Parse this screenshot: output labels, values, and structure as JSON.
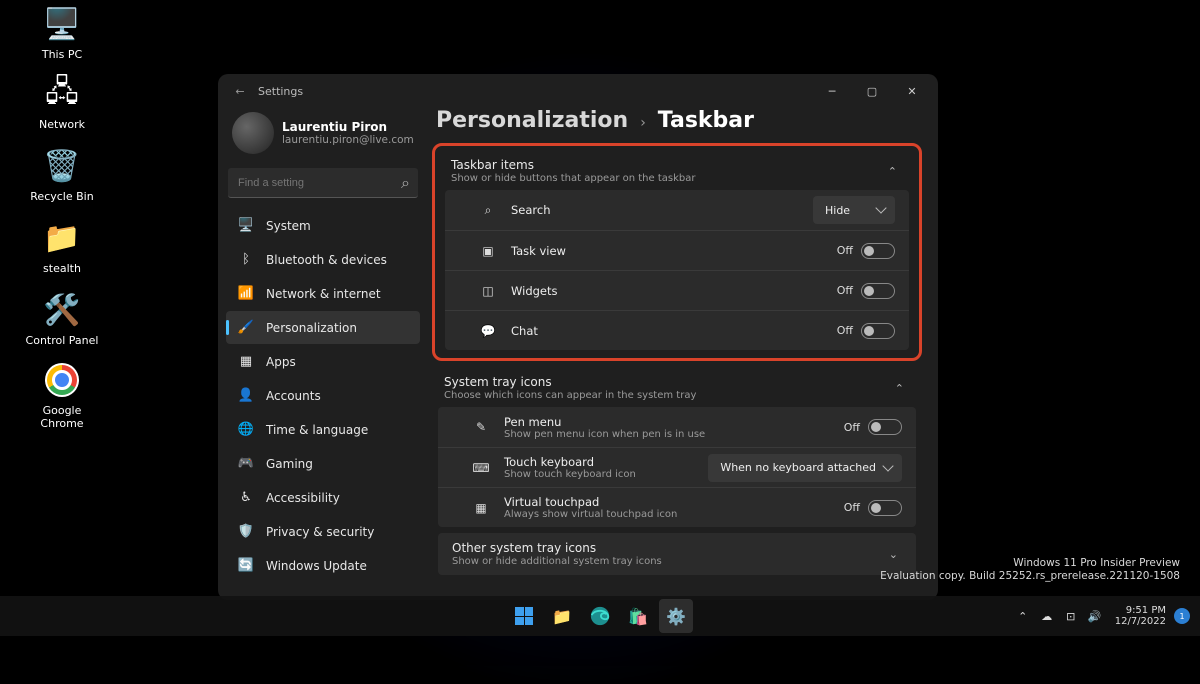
{
  "desktop_icons": [
    {
      "label": "This PC"
    },
    {
      "label": "Network"
    },
    {
      "label": "Recycle Bin"
    },
    {
      "label": "stealth"
    },
    {
      "label": "Control Panel"
    },
    {
      "label": "Google Chrome"
    }
  ],
  "window": {
    "title": "Settings",
    "user": {
      "name": "Laurentiu Piron",
      "email": "laurentiu.piron@live.com"
    },
    "search_placeholder": "Find a setting",
    "nav": [
      {
        "label": "System",
        "sel": false
      },
      {
        "label": "Bluetooth & devices",
        "sel": false
      },
      {
        "label": "Network & internet",
        "sel": false
      },
      {
        "label": "Personalization",
        "sel": true
      },
      {
        "label": "Apps",
        "sel": false
      },
      {
        "label": "Accounts",
        "sel": false
      },
      {
        "label": "Time & language",
        "sel": false
      },
      {
        "label": "Gaming",
        "sel": false
      },
      {
        "label": "Accessibility",
        "sel": false
      },
      {
        "label": "Privacy & security",
        "sel": false
      },
      {
        "label": "Windows Update",
        "sel": false
      }
    ],
    "breadcrumb": {
      "parent": "Personalization",
      "chev": "›",
      "current": "Taskbar"
    },
    "taskbar_items": {
      "title": "Taskbar items",
      "sub": "Show or hide buttons that appear on the taskbar",
      "rows": [
        {
          "label": "Search",
          "control": "drop",
          "value": "Hide"
        },
        {
          "label": "Task view",
          "control": "toggle",
          "state": "Off"
        },
        {
          "label": "Widgets",
          "control": "toggle",
          "state": "Off"
        },
        {
          "label": "Chat",
          "control": "toggle",
          "state": "Off"
        }
      ]
    },
    "systray": {
      "title": "System tray icons",
      "sub": "Choose which icons can appear in the system tray",
      "rows": [
        {
          "label": "Pen menu",
          "sub": "Show pen menu icon when pen is in use",
          "control": "toggle",
          "state": "Off"
        },
        {
          "label": "Touch keyboard",
          "sub": "Show touch keyboard icon",
          "control": "drop",
          "value": "When no keyboard attached"
        },
        {
          "label": "Virtual touchpad",
          "sub": "Always show virtual touchpad icon",
          "control": "toggle",
          "state": "Off"
        }
      ]
    },
    "other": {
      "title": "Other system tray icons",
      "sub": "Show or hide additional system tray icons"
    }
  },
  "watermark": {
    "l1": "Windows 11 Pro Insider Preview",
    "l2": "Evaluation copy. Build 25252.rs_prerelease.221120-1508"
  },
  "tray": {
    "time": "9:51 PM",
    "date": "12/7/2022",
    "badge": "1"
  }
}
